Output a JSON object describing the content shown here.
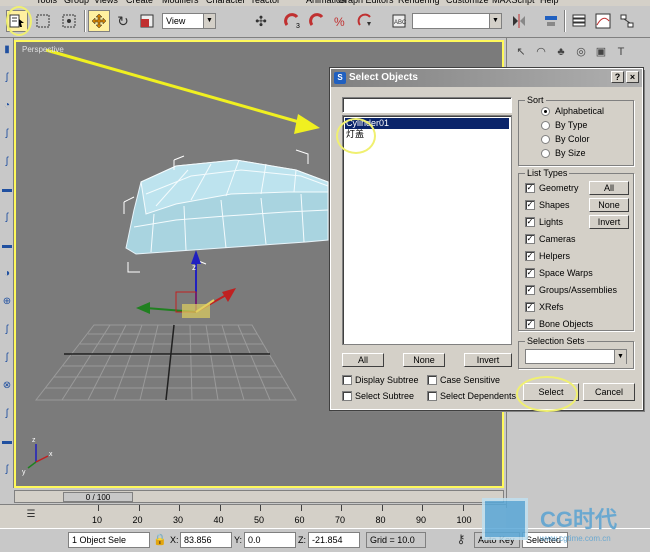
{
  "menubar": [
    "Tools",
    "Group",
    "Views",
    "Create",
    "Modifiers",
    "Character",
    "reactor",
    "Animation",
    "Graph Editors",
    "Rendering",
    "Customize",
    "MAXScript",
    "Help"
  ],
  "toolbar": {
    "view_select": "View"
  },
  "viewport": {
    "label": "Perspective"
  },
  "dialog": {
    "title": "Select Objects",
    "help_btn": "?",
    "close_btn": "×",
    "objects": [
      "Cylinder01",
      "灯盖"
    ],
    "list_buttons": {
      "all": "All",
      "none": "None",
      "invert": "Invert"
    },
    "options": {
      "display_subtree": "Display Subtree",
      "case_sensitive": "Case Sensitive",
      "select_subtree": "Select Subtree",
      "select_dependents": "Select Dependents"
    },
    "sort": {
      "title": "Sort",
      "options": [
        "Alphabetical",
        "By Type",
        "By Color",
        "By Size"
      ],
      "selected": "Alphabetical"
    },
    "list_types": {
      "title": "List Types",
      "items": [
        "Geometry",
        "Shapes",
        "Lights",
        "Cameras",
        "Helpers",
        "Space Warps",
        "Groups/Assemblies",
        "XRefs",
        "Bone Objects"
      ],
      "buttons": {
        "all": "All",
        "none": "None",
        "invert": "Invert"
      }
    },
    "selection_sets": {
      "title": "Selection Sets"
    },
    "select_btn": "Select",
    "cancel_btn": "Cancel"
  },
  "timeline": {
    "slider": "0 / 100",
    "ticks": [
      "10",
      "20",
      "30",
      "40",
      "50",
      "60",
      "70",
      "80",
      "90",
      "100"
    ]
  },
  "statusbar": {
    "selection": "1 Object Sele",
    "x_label": "X:",
    "x": "83.856",
    "y_label": "Y:",
    "y": "0.0",
    "z_label": "Z:",
    "z": "-21.854",
    "grid": "Grid = 10.0",
    "autokey": "Auto Key",
    "selected": "Selected"
  },
  "watermark": {
    "brand": "CG时代",
    "url": "www.cgtime.com.cn"
  },
  "colors": {
    "highlight": "#f0f070",
    "viewport": "#7b7b7b",
    "mesh": "#a9d4e0",
    "selection": "#0a246a"
  }
}
